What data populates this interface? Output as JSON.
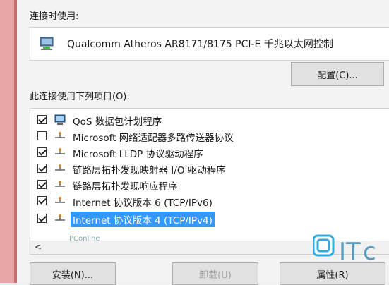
{
  "connection": {
    "label": "连接时使用:",
    "adapter_name": "Qualcomm Atheros AR8171/8175 PCI-E 千兆以太网控制"
  },
  "buttons": {
    "configure": "配置(C)...",
    "install": "安装(N)...",
    "uninstall": "卸载(U)",
    "properties": "属性(R)"
  },
  "items_label": "此连接使用下列项目(O):",
  "items": [
    {
      "label": "QoS 数据包计划程序",
      "checked": true,
      "icon": "qos-scheduler-icon"
    },
    {
      "label": "Microsoft 网络适配器多路传送器协议",
      "checked": false,
      "icon": "network-protocol-icon"
    },
    {
      "label": "Microsoft LLDP 协议驱动程序",
      "checked": true,
      "icon": "network-protocol-icon"
    },
    {
      "label": "链路层拓扑发现映射器 I/O 驱动程序",
      "checked": true,
      "icon": "network-protocol-icon"
    },
    {
      "label": "链路层拓扑发现响应程序",
      "checked": true,
      "icon": "network-protocol-icon"
    },
    {
      "label": "Internet 协议版本 6 (TCP/IPv6)",
      "checked": true,
      "icon": "network-protocol-icon"
    },
    {
      "label": "Internet 协议版本 4 (TCP/IPv4)",
      "checked": true,
      "icon": "network-protocol-icon",
      "selected": true
    }
  ],
  "watermark": {
    "text": "PConline"
  },
  "colors": {
    "selection": "#3399ff",
    "edge": "#e8a6a6"
  }
}
